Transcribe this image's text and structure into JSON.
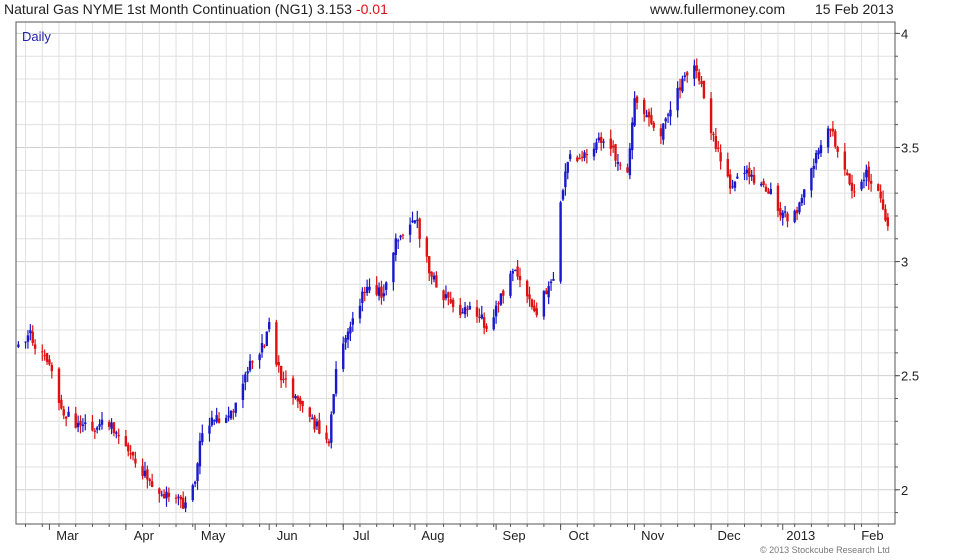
{
  "header": {
    "title": "Natural Gas NYME 1st Month Continuation (NG1)",
    "price": "3.153",
    "change": "-0.01",
    "site": "www.fullermoney.com",
    "date": "15 Feb 2013"
  },
  "copyright": "© 2013 Stockcube Research Ltd",
  "colors": {
    "up": "#1818cc",
    "down": "#dd1111",
    "grid": "#e0e0e0",
    "axis": "#555555",
    "change": "#dd1111",
    "interval": "#2222aa"
  },
  "chart_data": {
    "type": "ohlc",
    "interval_label": "Daily",
    "ylim": [
      1.85,
      4.05
    ],
    "yticks": [
      2,
      2.5,
      3,
      3.5,
      4
    ],
    "ytick_labels": [
      "2",
      "2.5",
      "3",
      "3.5",
      "4"
    ],
    "xlim": [
      "2012-02-16",
      "2013-02-18"
    ],
    "xtick_labels": [
      {
        "label": "Mar",
        "date": "2012-03-01"
      },
      {
        "label": "Apr",
        "date": "2012-04-02"
      },
      {
        "label": "May",
        "date": "2012-05-01"
      },
      {
        "label": "Jun",
        "date": "2012-06-01"
      },
      {
        "label": "Jul",
        "date": "2012-07-02"
      },
      {
        "label": "Aug",
        "date": "2012-08-01"
      },
      {
        "label": "Sep",
        "date": "2012-09-04"
      },
      {
        "label": "Oct",
        "date": "2012-10-01"
      },
      {
        "label": "Nov",
        "date": "2012-11-01"
      },
      {
        "label": "Dec",
        "date": "2012-12-03"
      },
      {
        "label": "2013",
        "date": "2013-01-02"
      },
      {
        "label": "Feb",
        "date": "2013-02-01"
      }
    ],
    "close_path": [
      [
        "2012-02-17",
        2.64
      ],
      [
        "2012-02-22",
        2.68
      ],
      [
        "2012-02-27",
        2.58
      ],
      [
        "2012-03-01",
        2.53
      ],
      [
        "2012-03-06",
        2.36
      ],
      [
        "2012-03-12",
        2.28
      ],
      [
        "2012-03-19",
        2.27
      ],
      [
        "2012-03-26",
        2.3
      ],
      [
        "2012-04-02",
        2.18
      ],
      [
        "2012-04-06",
        2.14
      ],
      [
        "2012-04-12",
        2.02
      ],
      [
        "2012-04-19",
        1.98
      ],
      [
        "2012-04-23",
        1.96
      ],
      [
        "2012-04-26",
        1.93
      ],
      [
        "2012-05-01",
        2.06
      ],
      [
        "2012-05-03",
        2.22
      ],
      [
        "2012-05-08",
        2.32
      ],
      [
        "2012-05-15",
        2.31
      ],
      [
        "2012-05-22",
        2.51
      ],
      [
        "2012-05-29",
        2.62
      ],
      [
        "2012-06-01",
        2.72
      ],
      [
        "2012-06-05",
        2.52
      ],
      [
        "2012-06-12",
        2.4
      ],
      [
        "2012-06-19",
        2.3
      ],
      [
        "2012-06-26",
        2.22
      ],
      [
        "2012-06-29",
        2.55
      ],
      [
        "2012-07-05",
        2.72
      ],
      [
        "2012-07-12",
        2.9
      ],
      [
        "2012-07-19",
        2.86
      ],
      [
        "2012-07-24",
        3.08
      ],
      [
        "2012-07-30",
        3.16
      ],
      [
        "2012-08-02",
        3.16
      ],
      [
        "2012-08-07",
        2.96
      ],
      [
        "2012-08-13",
        2.84
      ],
      [
        "2012-08-20",
        2.79
      ],
      [
        "2012-08-27",
        2.78
      ],
      [
        "2012-08-31",
        2.72
      ],
      [
        "2012-09-05",
        2.82
      ],
      [
        "2012-09-12",
        2.98
      ],
      [
        "2012-09-17",
        2.84
      ],
      [
        "2012-09-21",
        2.78
      ],
      [
        "2012-09-28",
        2.94
      ],
      [
        "2012-10-01",
        3.27
      ],
      [
        "2012-10-04",
        3.45
      ],
      [
        "2012-10-10",
        3.44
      ],
      [
        "2012-10-17",
        3.55
      ],
      [
        "2012-10-22",
        3.5
      ],
      [
        "2012-10-29",
        3.38
      ],
      [
        "2012-11-01",
        3.7
      ],
      [
        "2012-11-07",
        3.63
      ],
      [
        "2012-11-12",
        3.55
      ],
      [
        "2012-11-19",
        3.76
      ],
      [
        "2012-11-26",
        3.87
      ],
      [
        "2012-11-29",
        3.78
      ],
      [
        "2012-12-03",
        3.58
      ],
      [
        "2012-12-07",
        3.44
      ],
      [
        "2012-12-12",
        3.32
      ],
      [
        "2012-12-17",
        3.41
      ],
      [
        "2012-12-21",
        3.34
      ],
      [
        "2012-12-28",
        3.3
      ],
      [
        "2013-01-02",
        3.2
      ],
      [
        "2013-01-07",
        3.2
      ],
      [
        "2013-01-11",
        3.3
      ],
      [
        "2013-01-16",
        3.46
      ],
      [
        "2013-01-22",
        3.58
      ],
      [
        "2013-01-28",
        3.38
      ],
      [
        "2013-02-01",
        3.3
      ],
      [
        "2013-02-06",
        3.38
      ],
      [
        "2013-02-11",
        3.29
      ],
      [
        "2013-02-15",
        3.15
      ]
    ]
  }
}
